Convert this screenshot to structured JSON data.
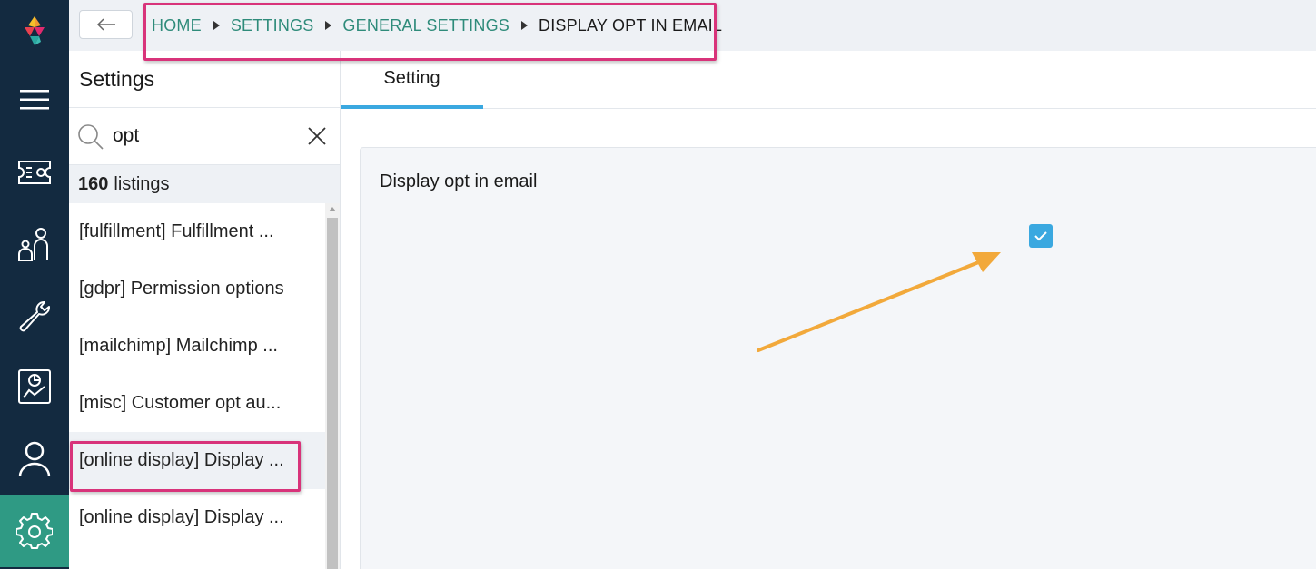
{
  "breadcrumb": {
    "home": "HOME",
    "settings": "SETTINGS",
    "general": "GENERAL SETTINGS",
    "current": "DISPLAY OPT IN EMAIL"
  },
  "rail": {
    "items": [
      "logo-icon",
      "menu-icon",
      "ticket-icon",
      "people-icon",
      "wrench-icon",
      "report-icon",
      "user-icon",
      "gear-icon"
    ],
    "active": "gear-icon",
    "active_color": "#2f9a84",
    "background": "#132a40"
  },
  "panel": {
    "title": "Settings",
    "search": {
      "value": "opt"
    },
    "count_number": "160",
    "count_label": "listings",
    "items": [
      {
        "label": "[fulfillment] Fulfillment ..."
      },
      {
        "label": "[gdpr] Permission options"
      },
      {
        "label": "[mailchimp] Mailchimp ..."
      },
      {
        "label": "[misc] Customer opt au..."
      },
      {
        "label": "[online display] Display ..."
      },
      {
        "label": "[online display] Display ..."
      }
    ],
    "selected_index": 4
  },
  "tabs": [
    {
      "label": "Setting",
      "active": true
    }
  ],
  "setting": {
    "label": "Display opt in email",
    "checked": true
  },
  "colors": {
    "accent": "#3aa8e0",
    "link": "#2e8b7a",
    "annotation_box": "#d8337a",
    "annotation_arrow": "#f2a93b"
  }
}
